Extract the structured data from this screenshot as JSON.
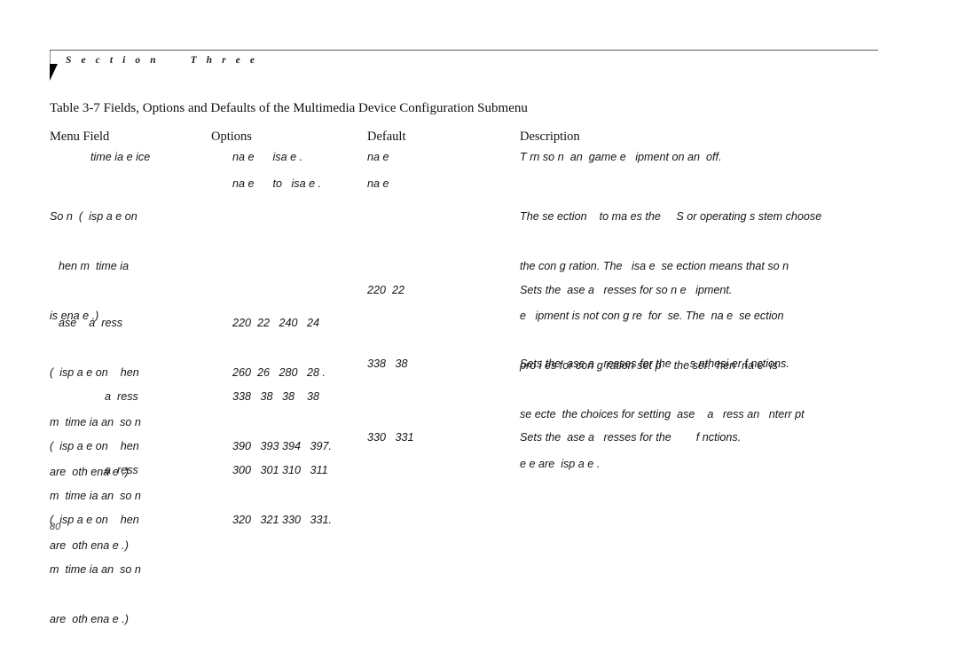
{
  "header": {
    "section_label": "S e c t i o n     T h r e e"
  },
  "caption": "Table 3-7 Fields, Options and Defaults of the Multimedia Device Configuration Submenu",
  "table": {
    "columns": [
      {
        "key": "menu_field",
        "label": "Menu Field"
      },
      {
        "key": "options",
        "label": "Options"
      },
      {
        "key": "default",
        "label": "Default"
      },
      {
        "key": "description",
        "label": "Description"
      }
    ],
    "rows": [
      {
        "menu_field_lines": [
          "time ia e ice"
        ],
        "options_lines": [
          "na e      isa e ."
        ],
        "default_lines": [
          "na e"
        ],
        "description_lines": [
          "T rn so n  an  game e   ipment on an  off."
        ]
      },
      {
        "menu_field_lines": [
          "So n  (  isp a e on",
          "hen m  time ia",
          "is ena e .)"
        ],
        "options_lines": [
          "na e      to   isa e ."
        ],
        "default_lines": [
          "na e"
        ],
        "description_lines": [
          "The se ection    to ma es the     S or operating s stem choose",
          "the con g ration. The   isa e  se ection means that so n",
          "e   ipment is not con g re  for  se. The  na e  se ection",
          "pro i es for con g ration set p    the ser.  hen  na e  is",
          "se ecte  the choices for setting  ase    a   ress an   nterr pt",
          "e e are  isp a e ."
        ]
      },
      {
        "menu_field_lines": [
          "ase    a  ress",
          "(  isp a e on    hen",
          "m  time ia an  so n",
          "are  oth ena e .)"
        ],
        "options_lines": [
          "220  22   240   24",
          "260  26   280   28 ."
        ],
        "default_lines": [
          "220  22"
        ],
        "description_lines": [
          "Sets the  ase a   resses for so n e   ipment."
        ]
      },
      {
        "menu_field_lines": [
          "a  ress",
          "(  isp a e on    hen",
          "m  time ia an  so n",
          "are  oth ena e .)"
        ],
        "options_lines": [
          "338   38   38    38",
          "390   393 394   397."
        ],
        "default_lines": [
          "338   38"
        ],
        "description_lines": [
          "Sets the  ase a   resses for the      s nthesi er f nctions."
        ]
      },
      {
        "menu_field_lines": [
          "a  ress",
          "(  isp a e on    hen",
          "m  time ia an  so n",
          "are  oth ena e .)"
        ],
        "options_lines": [
          "300   301 310   311",
          "320   321 330   331."
        ],
        "default_lines": [
          "330   331"
        ],
        "description_lines": [
          "Sets the  ase a   resses for the        f nctions."
        ]
      }
    ]
  },
  "folio": "80"
}
